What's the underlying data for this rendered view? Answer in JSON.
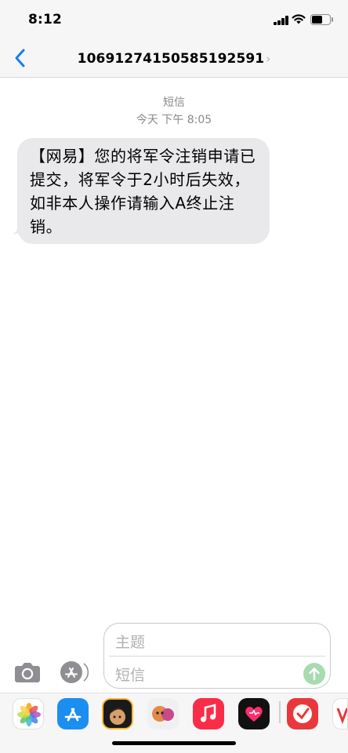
{
  "status": {
    "time": "8:12"
  },
  "header": {
    "contact": "10691274150585192591",
    "chevron": "›"
  },
  "thread": {
    "service": "短信",
    "timestamp": "今天 下午 8:05",
    "message": "【网易】您的将军令注销申请已提交，将军令于2小时后失效，如非本人操作请输入A终止注销。"
  },
  "composer": {
    "subject_placeholder": "主题",
    "body_placeholder": "短信"
  },
  "colors": {
    "accent": "#1a7cf5",
    "bubble": "#e9e9eb",
    "send": "#a7dcae"
  },
  "drawer_apps": [
    "photos-icon",
    "app-store-icon",
    "memoji-icon",
    "animoji-icon",
    "music-icon",
    "fitness-heart-icon",
    "red-app-icon",
    "partial-app-icon"
  ]
}
